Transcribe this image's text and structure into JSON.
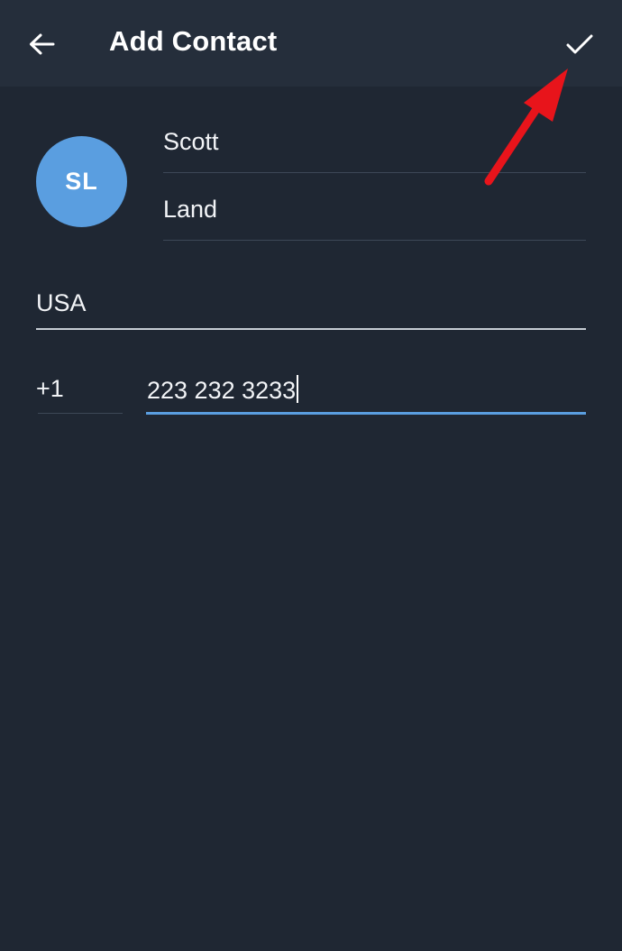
{
  "appbar": {
    "title": "Add Contact",
    "back_icon": "arrow-left-icon",
    "confirm_icon": "checkmark-icon"
  },
  "contact": {
    "avatar_initials": "SL",
    "first_name": "Scott",
    "last_name": "Land",
    "country": "USA",
    "country_code": "+1",
    "phone_number": "223 232 3233"
  },
  "colors": {
    "background": "#1f2733",
    "appbar": "#252e3b",
    "accent": "#5a9ee0",
    "annotation_arrow": "#e8141b"
  }
}
